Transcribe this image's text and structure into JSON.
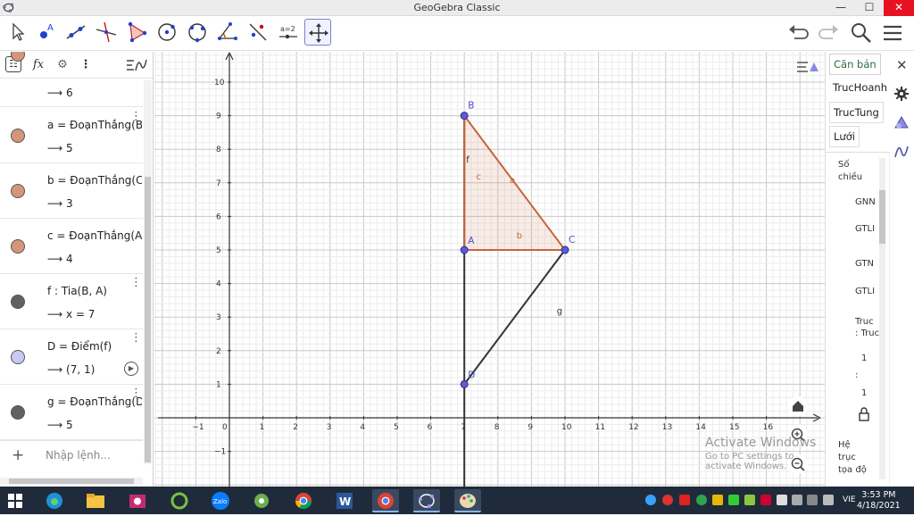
{
  "window": {
    "title": "GeoGebra Classic"
  },
  "algebra": {
    "items": [
      {
        "definition": "",
        "value": "⟶  6",
        "color": "#d4967a"
      },
      {
        "definition": "a = ĐoạnThẳng(B",
        "value": "⟶  5",
        "color": "#d4967a"
      },
      {
        "definition": "b = ĐoạnThẳng(C",
        "value": "⟶  3",
        "color": "#d4967a"
      },
      {
        "definition": "c = ĐoạnThẳng(A",
        "value": "⟶  4",
        "color": "#d4967a"
      },
      {
        "definition": "f : Tia(B, A)",
        "value": "⟶  x = 7",
        "color": "#616161"
      },
      {
        "definition": "D = Điểm(f)",
        "value": "⟶  (7, 1)",
        "color": "#c8c8f4"
      },
      {
        "definition": "g = ĐoạnThẳng(D",
        "value": "⟶  5",
        "color": "#616161"
      }
    ],
    "input_placeholder": "Nhập lệnh..."
  },
  "graphics": {
    "x_ticks": [
      "−1",
      "0",
      "1",
      "2",
      "3",
      "4",
      "5",
      "6",
      "7",
      "8",
      "9",
      "10",
      "11",
      "12",
      "13",
      "14",
      "15",
      "16"
    ],
    "y_ticks": [
      "10",
      "9",
      "8",
      "7",
      "6",
      "5",
      "4",
      "3",
      "2",
      "1",
      "−1"
    ],
    "points": [
      {
        "name": "A",
        "x": 7,
        "y": 5
      },
      {
        "name": "B",
        "x": 7,
        "y": 9
      },
      {
        "name": "C",
        "x": 10,
        "y": 5
      },
      {
        "name": "D",
        "x": 7,
        "y": 1
      }
    ],
    "segment_labels": {
      "a": "a",
      "b": "b",
      "c": "c",
      "f": "f",
      "g": "g"
    },
    "polygon_color": "#c8643c",
    "line_color": "#333333"
  },
  "watermark": {
    "line1": "Activate Windows",
    "line2": "Go to PC settings to activate Windows."
  },
  "properties": {
    "tabs": [
      "Căn bản",
      "TrucHoanh",
      "TrucTung",
      "Lưới"
    ],
    "labels": [
      "Số",
      "chiều",
      "GNN",
      "GTLI",
      "GTN",
      "GTLI",
      "Truc",
      ": Truc",
      "1",
      ":",
      "1",
      "Hệ",
      "trục",
      "tọa độ"
    ]
  },
  "taskbar": {
    "time": "3:53 PM",
    "date": "4/18/2021",
    "lang": "VIE"
  }
}
